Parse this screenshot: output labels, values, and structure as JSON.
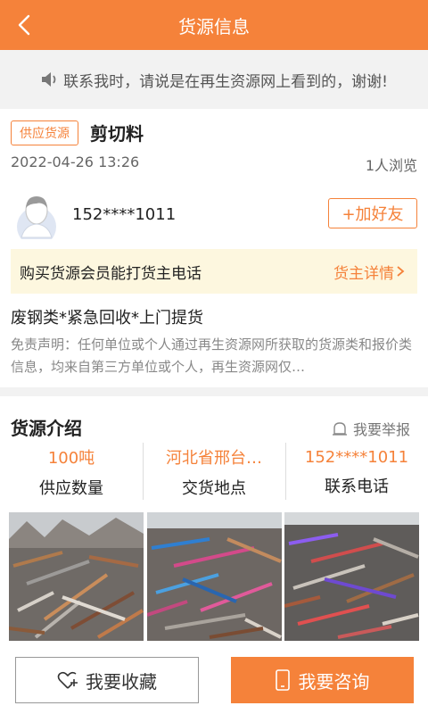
{
  "header": {
    "title": "货源信息"
  },
  "notice": {
    "text": "联系我时，请说是在再生资源网上看到的，谢谢!"
  },
  "listing": {
    "tag": "供应货源",
    "name": "剪切料",
    "date": "2022-04-26 13:26",
    "views": "1人浏览"
  },
  "seller": {
    "phone": "152****1011",
    "add_friend": "+加好友"
  },
  "vip_bar": {
    "text": "购买货源会员能打货主电话",
    "link": "货主详情"
  },
  "description": "废钢类*紧急回收*上门提货",
  "disclaimer": "免责声明：任何单位或个人通过再生资源网所获取的货源类和报价类信息，均来自第三方单位或个人，再生资源网仅…",
  "intro": {
    "title": "货源介绍",
    "report": "我要举报",
    "stats": [
      {
        "value": "100吨",
        "label": "供应数量"
      },
      {
        "value": "河北省邢台…",
        "label": "交货地点"
      },
      {
        "value": "152****1011",
        "label": "联系电话"
      }
    ]
  },
  "footer": {
    "favorite": "我要收藏",
    "consult": "我要咨询"
  },
  "colors": {
    "accent": "#f5823a",
    "vip_bg": "#fdf7df"
  }
}
